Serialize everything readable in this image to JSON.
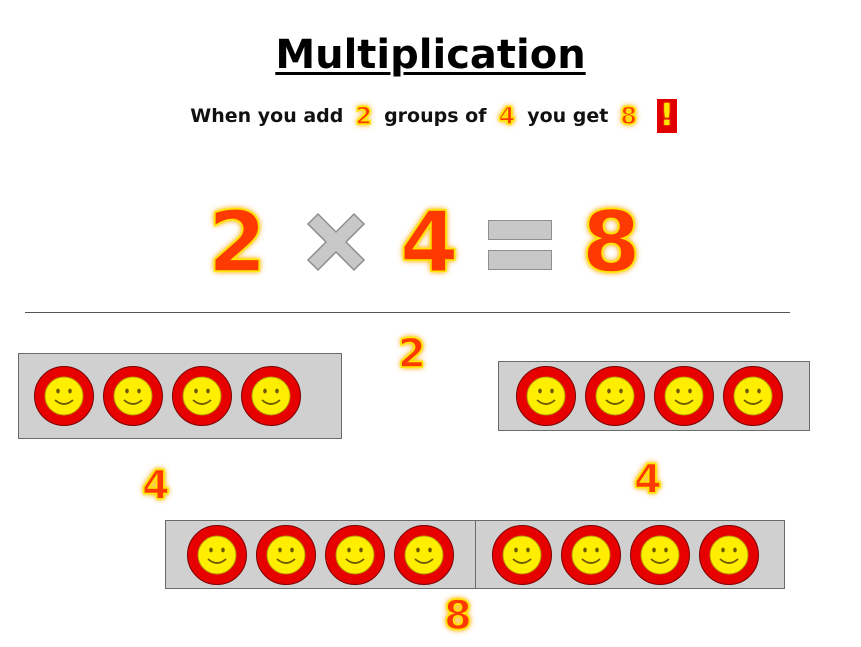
{
  "title": "Multiplication",
  "sentence": {
    "part1": "When you add",
    "num_groups": "2",
    "part2": "groups of",
    "group_size": "4",
    "part3": "you get",
    "result": "8",
    "exclaim": "!"
  },
  "equation": {
    "left": "2",
    "right": "4",
    "result": "8",
    "operator": "times-sign",
    "equals": "equals-sign"
  },
  "labels": {
    "groups_count": "2",
    "group_a_size": "4",
    "group_b_size": "4",
    "total": "8"
  },
  "groups": {
    "group_a_items": 4,
    "group_b_items": 4,
    "combined_items": 8
  },
  "colors": {
    "smiley_face": "#ffee00",
    "smiley_ring": "#e60000",
    "group_box": "#d0d0d0",
    "fire_text": "#ff3a00",
    "glow": "#ffe600"
  },
  "icons": [
    "smiley-face-icon",
    "times-sign-icon",
    "equals-sign-icon"
  ]
}
